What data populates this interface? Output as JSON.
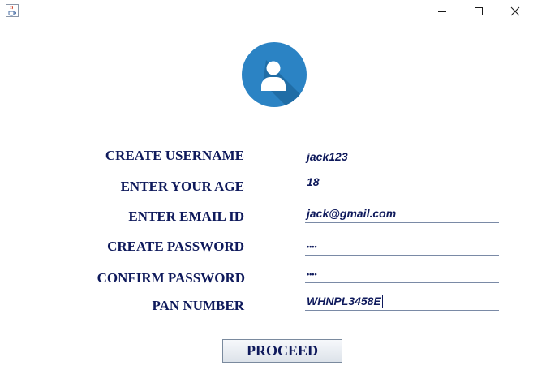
{
  "window": {
    "icon": "java-cup-icon",
    "controls": [
      "minimize-icon",
      "maximize-icon",
      "close-icon"
    ]
  },
  "avatar": {
    "icon": "user-avatar-icon",
    "color": "#2b83c4"
  },
  "form": {
    "username_label": "CREATE USERNAME",
    "username_value": "jack123",
    "age_label": "ENTER YOUR AGE",
    "age_value": "18",
    "email_label": "ENTER EMAIL ID",
    "email_value": "jack@gmail.com",
    "password_label": "CREATE PASSWORD",
    "password_value": "••••",
    "confirm_label": "CONFIRM PASSWORD",
    "confirm_value": "••••",
    "pan_label": "PAN NUMBER",
    "pan_value": "WHNPL3458E"
  },
  "actions": {
    "proceed_label": "PROCEED"
  },
  "colors": {
    "label_text": "#0f1a5c",
    "field_underline": "#7a8aa6"
  }
}
